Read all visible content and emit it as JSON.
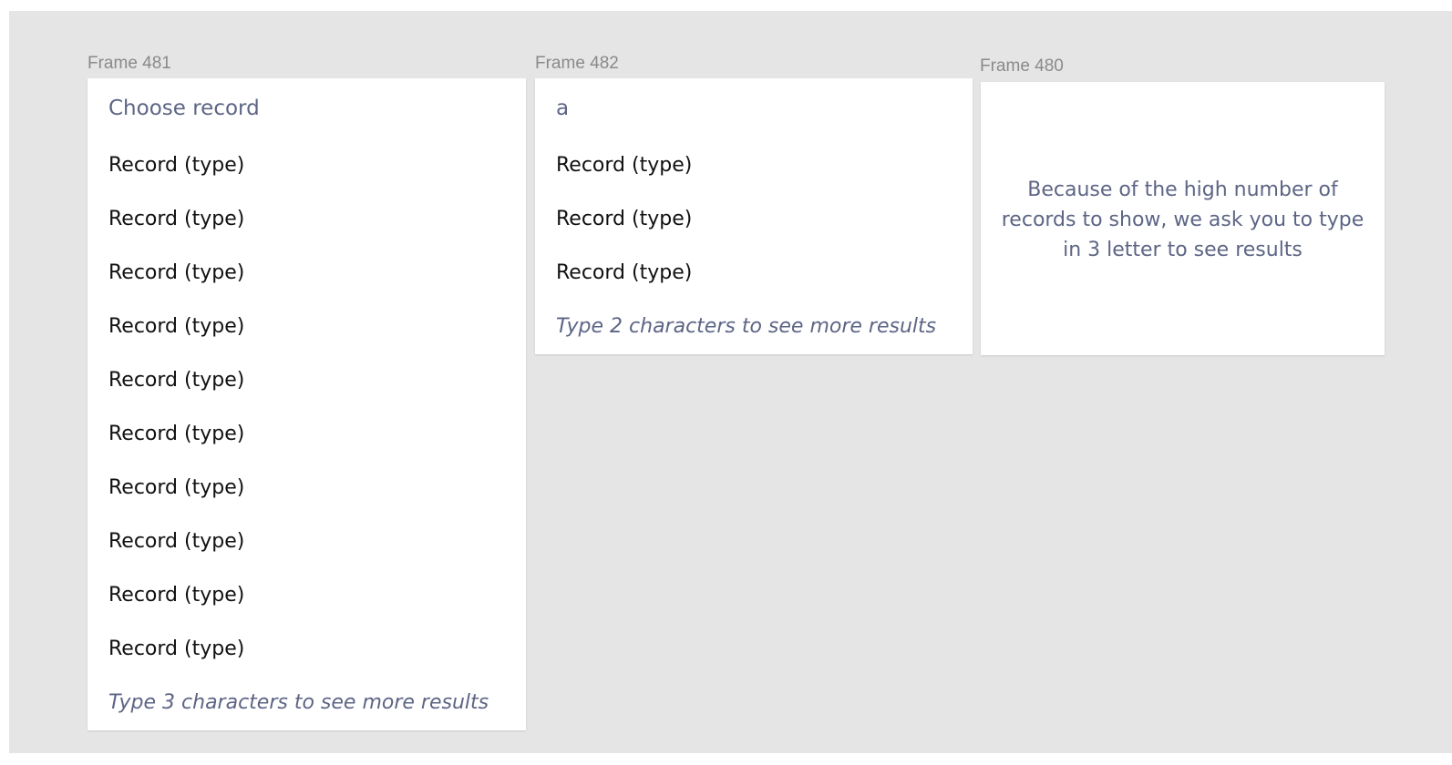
{
  "frames": {
    "f481": {
      "label": "Frame 481",
      "search_placeholder": "Choose record",
      "records": [
        "Record (type)",
        "Record (type)",
        "Record (type)",
        "Record (type)",
        "Record (type)",
        "Record (type)",
        "Record (type)",
        "Record (type)",
        "Record (type)",
        "Record (type)"
      ],
      "hint": "Type 3 characters to see more results"
    },
    "f482": {
      "label": "Frame 482",
      "search_value": "a",
      "records": [
        "Record (type)",
        "Record (type)",
        "Record (type)"
      ],
      "hint": "Type 2 characters to see more results"
    },
    "f480": {
      "label": "Frame 480",
      "message": "Because of the high number of records to show, we ask you to type in 3 letter to see results"
    }
  },
  "colors": {
    "canvas": "#e5e5e5",
    "frame_background": "#ffffff",
    "frame_label": "#8a8a8a",
    "muted_text": "#5d6585",
    "record_text": "#111111"
  }
}
